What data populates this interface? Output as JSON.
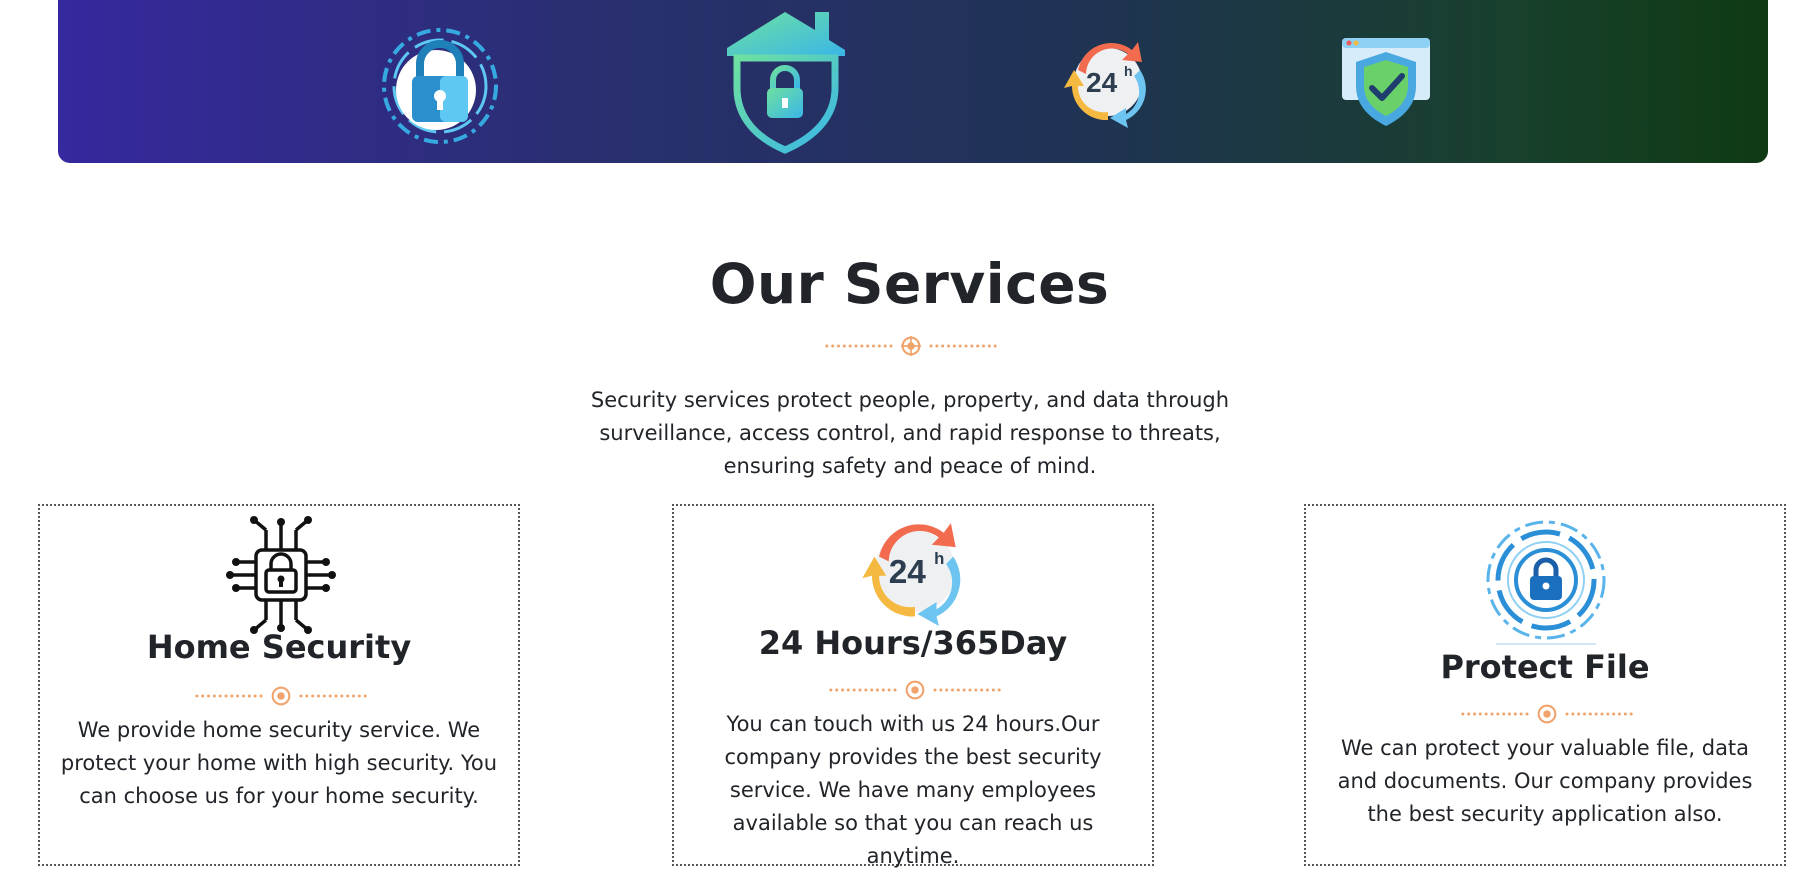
{
  "banner": {
    "icons": [
      "circuit-padlock-icon",
      "house-shield-lock-icon",
      "24-hours-icon",
      "browser-shield-check-icon"
    ]
  },
  "services": {
    "title": "Our Services",
    "intro": "Security services protect people, property, and data through surveillance, access control, and rapid response to threats, ensuring safety and peace of mind.",
    "cards": [
      {
        "icon": "circuit-lock-icon",
        "title": "Home Security",
        "text": "We provide home security service. We protect your home with high security. You can choose us for your home security."
      },
      {
        "icon": "24-hours-icon",
        "title": "24 Hours/365Day",
        "text": "You can touch with us 24 hours.Our company provides the best security service. We have many employees available so that you can reach us anytime."
      },
      {
        "icon": "digital-padlock-icon",
        "title": "Protect File",
        "text": "We can protect your valuable file, data and documents. Our company provides the best security application also."
      }
    ]
  },
  "colors": {
    "accent_orange": "#f0a46b",
    "banner_start": "#36289e",
    "banner_end": "#0f3a14",
    "text": "#212529"
  }
}
